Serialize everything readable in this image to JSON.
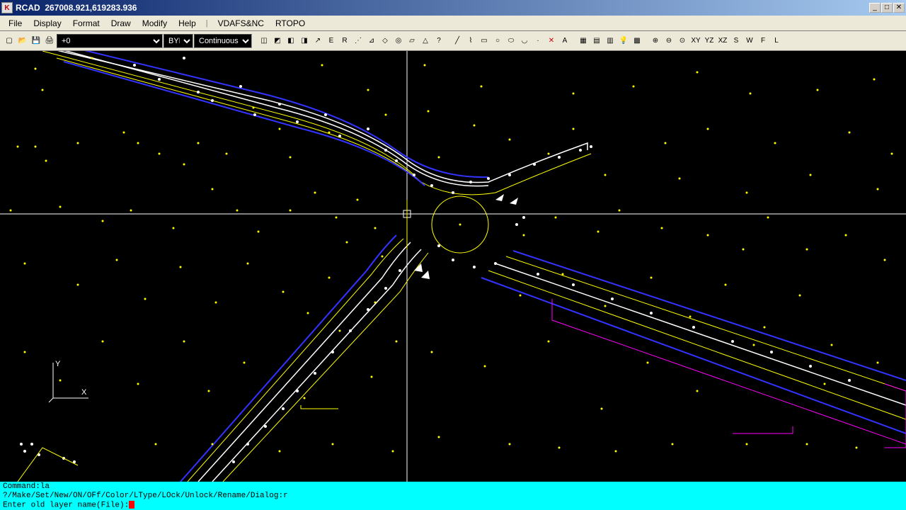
{
  "title": {
    "app": "RCAD",
    "coords": "267008.921,619283.936"
  },
  "menus": [
    "File",
    "Display",
    "Format",
    "Draw",
    "Modify",
    "Help"
  ],
  "extra_menus": [
    "VDAFS&NC",
    "RTOPO"
  ],
  "toolbar": {
    "layer_value": "+0",
    "color_value": "BYL",
    "linetype_value": "Continuous"
  },
  "view_buttons": [
    "XY",
    "YZ",
    "XZ",
    "S",
    "W",
    "F",
    "L"
  ],
  "command": {
    "line1": "Command:la",
    "line2": "?/Make/Set/New/ON/OFf/Color/LType/LOck/Unlock/Rename/Dialog:r",
    "line3": "Enter old layer name(File):"
  },
  "ucs": {
    "x": "X",
    "y": "Y"
  },
  "win_buttons": {
    "min": "_",
    "max": "□",
    "close": "✕"
  }
}
